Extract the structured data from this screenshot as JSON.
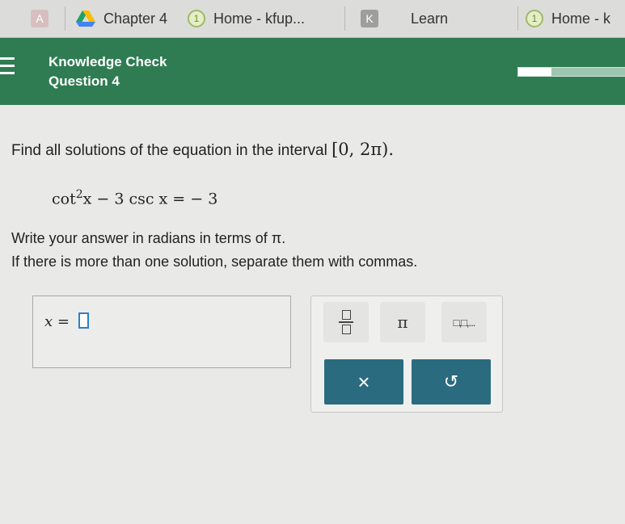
{
  "browser": {
    "tabs": [
      {
        "icon": "letter-a-icon",
        "icon_text": "A",
        "label": ""
      },
      {
        "icon": "google-drive-icon",
        "label": "Chapter 4"
      },
      {
        "icon": "home-circle-icon",
        "icon_text": "1",
        "label": "Home - kfup..."
      },
      {
        "icon": "letter-k-icon",
        "icon_text": "K",
        "label": "Learn"
      },
      {
        "icon": "home-circle-icon",
        "icon_text": "1",
        "label": "Home - k"
      }
    ]
  },
  "header": {
    "title": "Knowledge Check",
    "subtitle": "Question 4",
    "progress": 0.3
  },
  "question": {
    "prompt": "Find all solutions of the equation in the interval",
    "interval": "[0, 2π).",
    "equation_cot": "cot",
    "equation_exp": "2",
    "equation_rest": "x − 3 csc x = − 3",
    "instruction_1": "Write your answer in radians in terms of π.",
    "instruction_2": "If there is more than one solution, separate them with commas."
  },
  "answer": {
    "label": "x =",
    "value": ""
  },
  "keypad": {
    "pi_label": "π",
    "list_label": "□,□,...",
    "clear_label": "×",
    "undo_label": "↺"
  },
  "colors": {
    "header_green": "#2f7c52",
    "action_teal": "#2b6b80",
    "input_border": "#2f7ec9"
  }
}
